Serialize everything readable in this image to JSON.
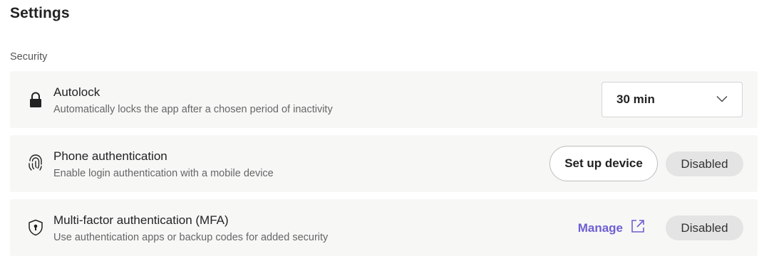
{
  "page": {
    "title": "Settings"
  },
  "security": {
    "label": "Security",
    "autolock": {
      "name": "Autolock",
      "description": "Automatically locks the app after a chosen period of inactivity",
      "selected_value": "30 min",
      "icon": "lock-icon"
    },
    "phone_auth": {
      "name": "Phone authentication",
      "description": "Enable login authentication with a mobile device",
      "button_label": "Set up device",
      "status": "Disabled",
      "icon": "fingerprint-icon"
    },
    "mfa": {
      "name": "Multi-factor authentication (MFA)",
      "description": "Use authentication apps or backup codes for added security",
      "link_label": "Manage",
      "status": "Disabled",
      "icon": "shield-keyhole-icon"
    }
  },
  "colors": {
    "accent": "#6e5fd3",
    "row_background": "#f7f7f6",
    "status_pill": "#e4e4e4"
  }
}
